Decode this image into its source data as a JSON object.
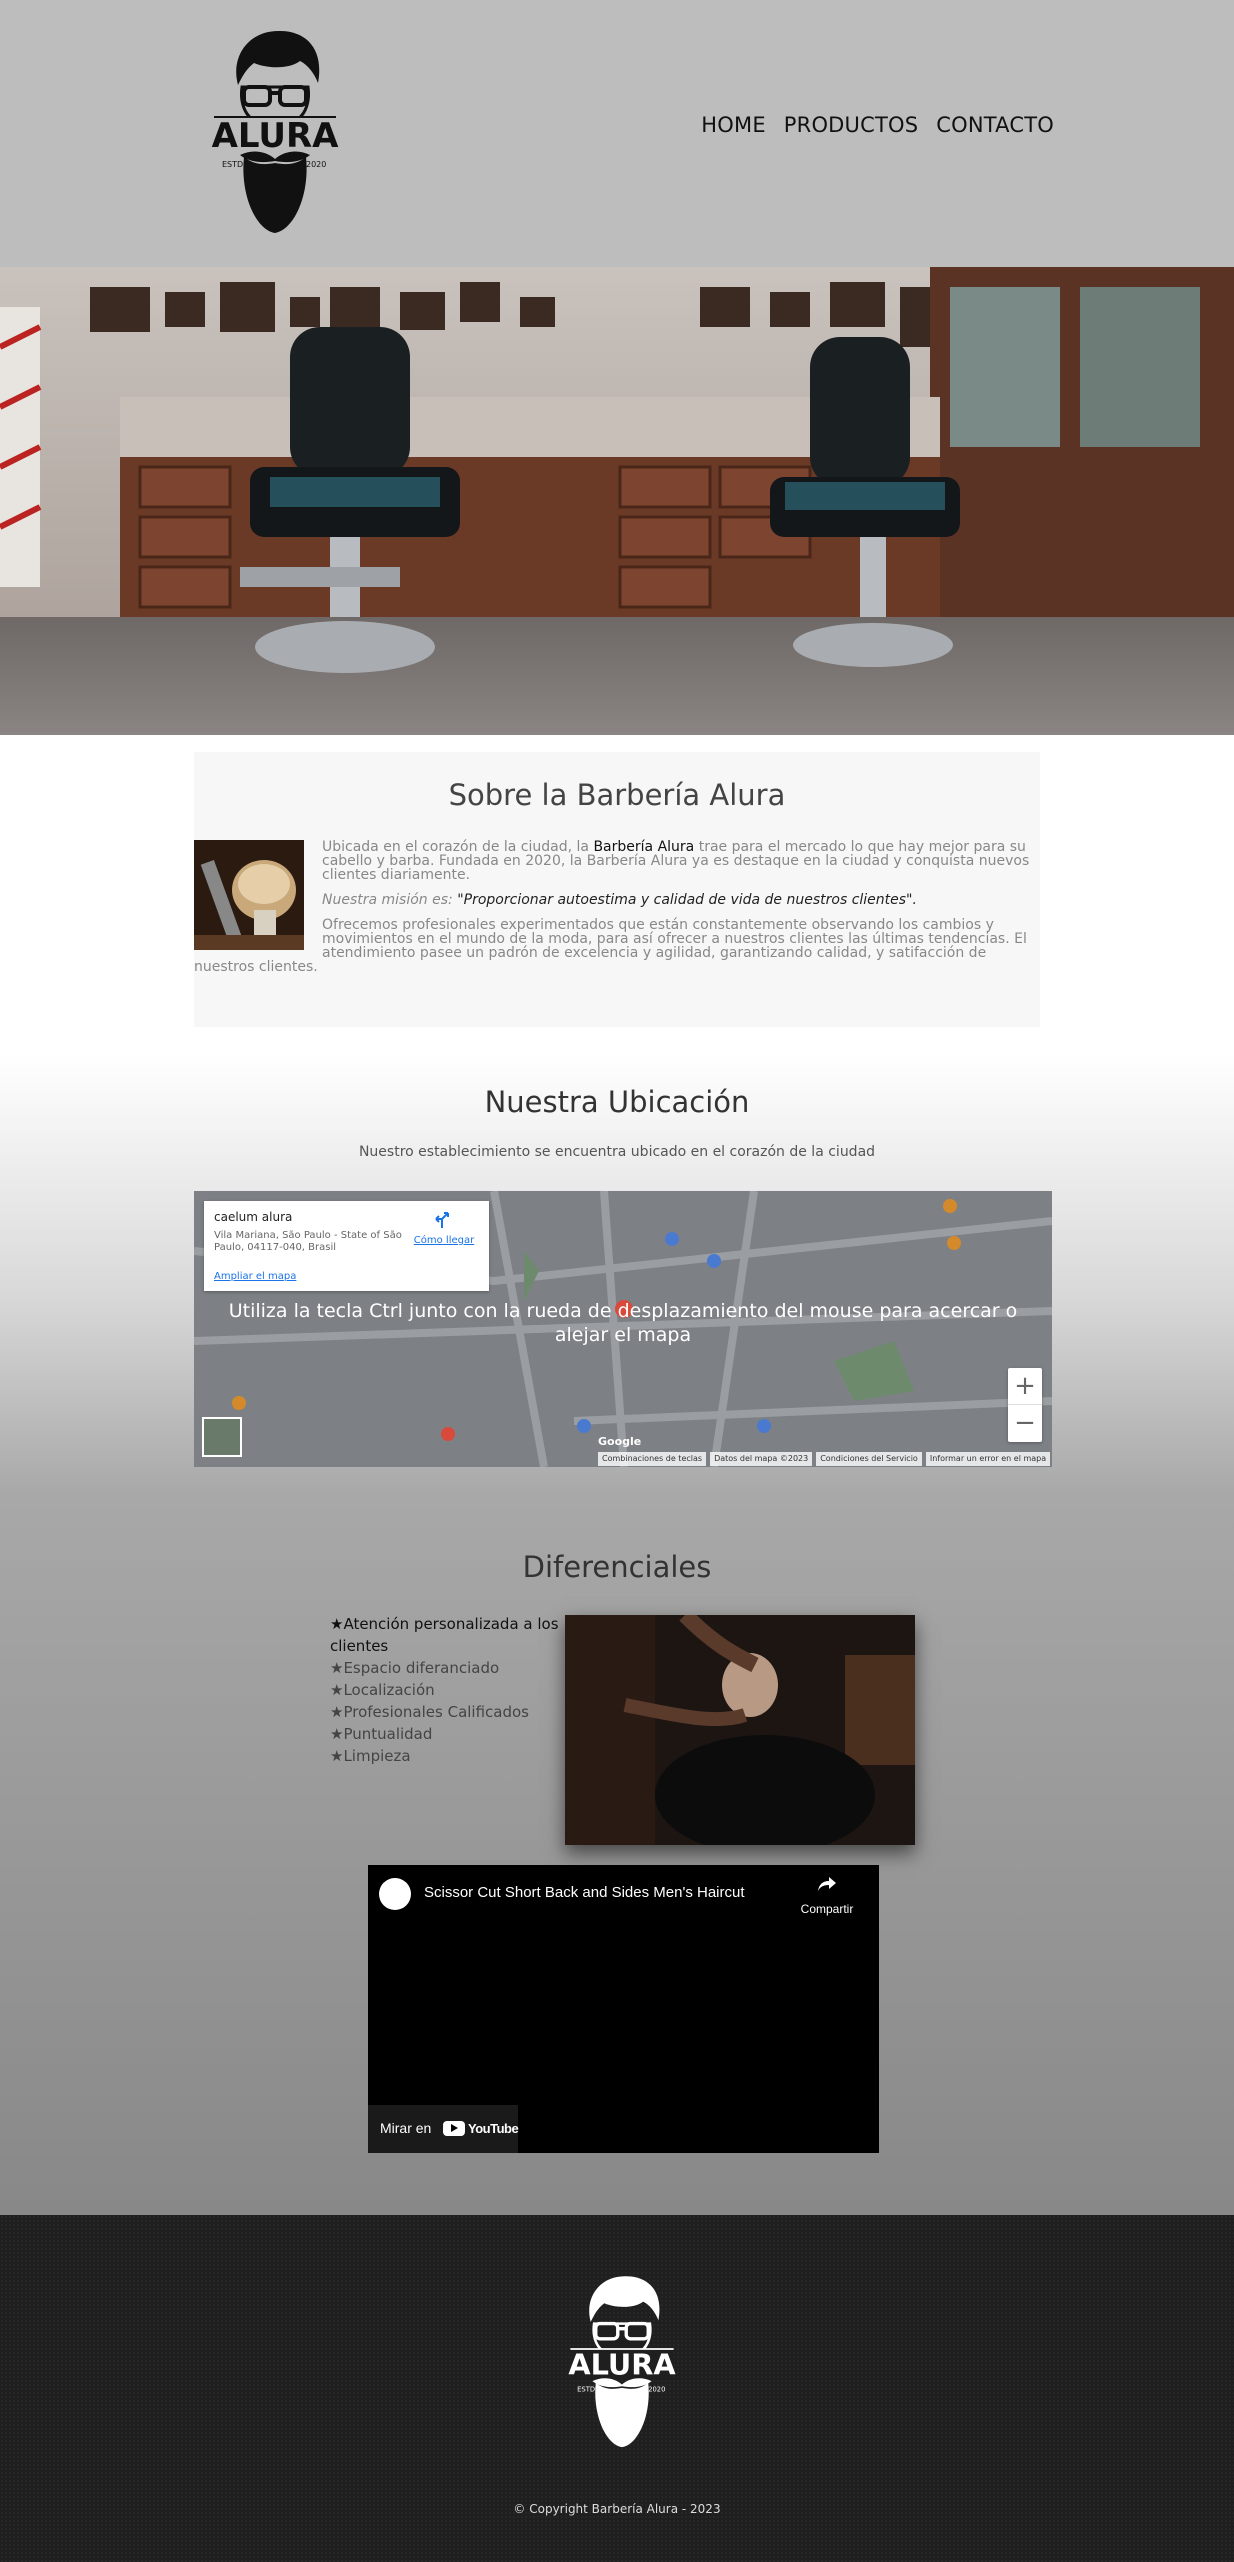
{
  "header": {
    "logo_text": "ALURA",
    "logo_est": "ESTD",
    "logo_year": "2020",
    "nav": [
      "HOME",
      "PRODUCTOS",
      "CONTACTO"
    ]
  },
  "about": {
    "title": "Sobre la Barbería Alura",
    "p1_before": "Ubicada en el corazón de la ciudad, la ",
    "p1_brand": "Barbería Alura",
    "p1_after": " trae para el mercado lo que hay mejor para su cabello y barba. Fundada en 2020, la Barbería Alura ya es destaque en la ciudad y conquista nuevos clientes diariamente.",
    "mission_label": "Nuestra misión es:",
    "mission_quote": " \"Proporcionar autoestima y calidad de vida de nuestros clientes\".",
    "p3": "Ofrecemos profesionales experimentados que están constantemente observando los cambios y movimientos en el mundo de la moda, para así ofrecer a nuestros clientes las últimas tendencias. El atendimiento pasee un padrón de excelencia y agilidad, garantizando calidad, y satifacción de nuestros clientes."
  },
  "location": {
    "title": "Nuestra Ubicación",
    "subtitle": "Nuestro establecimiento se encuentra ubicado en el corazón de la ciudad",
    "map": {
      "place_name": "caelum alura",
      "address": "Vila Mariana, São Paulo - State of São Paulo, 04117-040, Brasil",
      "enlarge_link": "Ampliar el mapa",
      "directions_label": "Cómo llegar",
      "hint": "Utiliza la tecla Ctrl junto con la rueda de desplazamiento del mouse para acercar o alejar el mapa",
      "zoom_in": "+",
      "zoom_out": "−",
      "google": "Google",
      "attribution": [
        "Combinaciones de teclas",
        "Datos del mapa ©2023",
        "Condiciones del Servicio",
        "Informar un error en el mapa"
      ]
    }
  },
  "diferenciales": {
    "title": "Diferenciales",
    "items": [
      "★Atención personalizada a los clientes",
      "★Espacio diferanciado",
      "★Localización",
      "★Profesionales Calificados",
      "★Puntualidad",
      "★Limpieza"
    ],
    "video": {
      "title": "Scissor Cut Short Back and Sides Men's Haircut",
      "share": "Compartir",
      "watch_on": "Mirar en",
      "youtube": "YouTube"
    }
  },
  "footer": {
    "logo_text": "ALURA",
    "logo_est": "ESTD",
    "logo_year": "2020",
    "copyright": "© Copyright Barbería Alura - 2023"
  }
}
